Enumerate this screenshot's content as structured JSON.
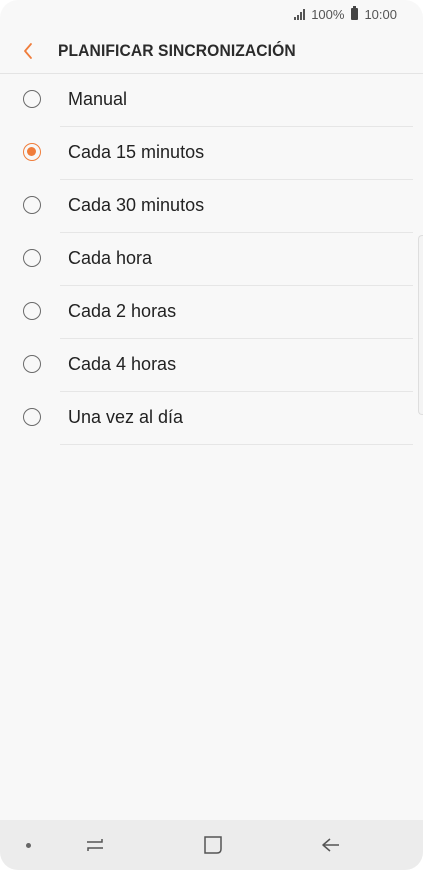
{
  "status_bar": {
    "battery": "100%",
    "time": "10:00"
  },
  "header": {
    "title": "PLANIFICAR SINCRONIZACIÓN",
    "back_icon": "chevron-left-icon",
    "accent_color": "#f07d3b"
  },
  "options": [
    {
      "label": "Manual",
      "selected": false
    },
    {
      "label": "Cada 15 minutos",
      "selected": true
    },
    {
      "label": "Cada 30 minutos",
      "selected": false
    },
    {
      "label": "Cada hora",
      "selected": false
    },
    {
      "label": "Cada 2 horas",
      "selected": false
    },
    {
      "label": "Cada 4 horas",
      "selected": false
    },
    {
      "label": "Una vez al día",
      "selected": false
    }
  ],
  "nav_bar": {
    "recent_icon": "recent-apps-icon",
    "home_icon": "home-icon",
    "back_icon": "back-arrow-icon"
  }
}
